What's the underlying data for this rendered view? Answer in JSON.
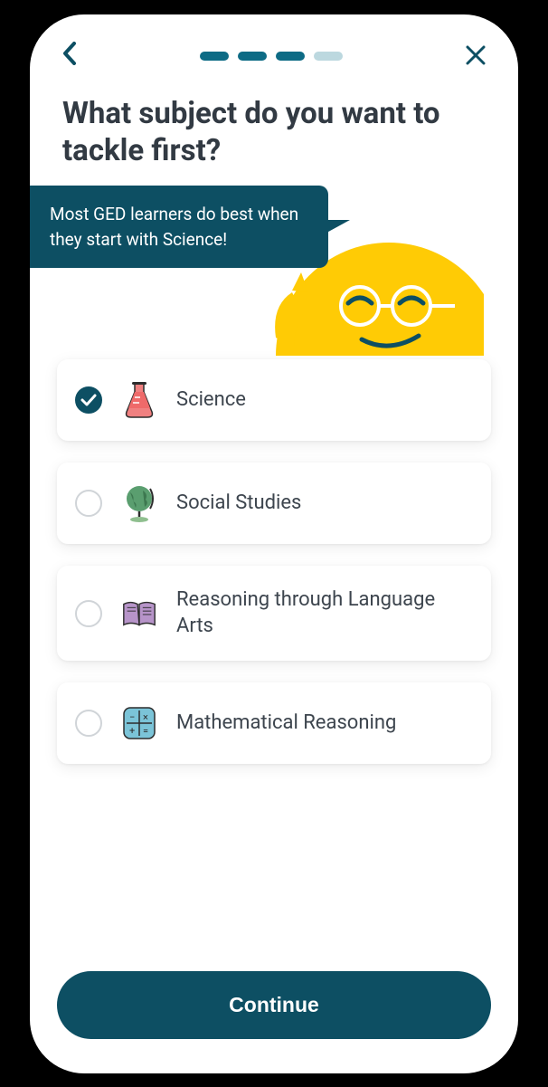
{
  "progress": {
    "total": 4,
    "active": 3
  },
  "question": "What subject do you want to tackle first?",
  "tip": "Most GED learners do best when they start with Science!",
  "options": [
    {
      "id": "science",
      "label": "Science",
      "selected": true,
      "icon": "flask-icon"
    },
    {
      "id": "social-studies",
      "label": "Social Studies",
      "selected": false,
      "icon": "globe-icon"
    },
    {
      "id": "rla",
      "label": "Reasoning through Language Arts",
      "selected": false,
      "icon": "book-icon"
    },
    {
      "id": "math",
      "label": "Mathematical Reasoning",
      "selected": false,
      "icon": "math-icon"
    }
  ],
  "cta": "Continue",
  "colors": {
    "primary": "#0d4f63",
    "accent": "#ffcb05"
  }
}
